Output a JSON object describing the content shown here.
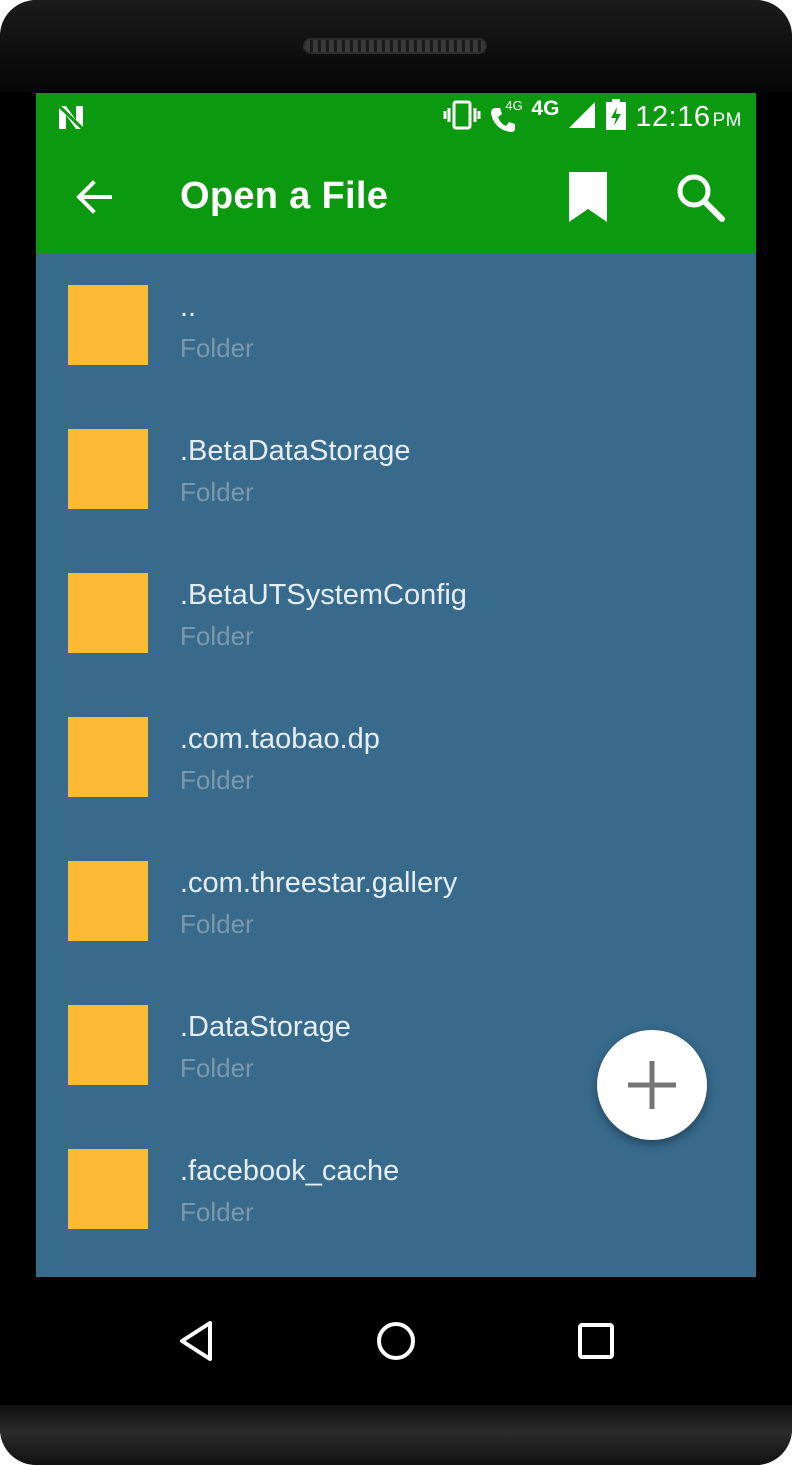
{
  "status_bar": {
    "network_label": "4G",
    "call_network_label": "4G",
    "time": "12:16",
    "ampm": "PM",
    "icons": [
      "n-notification-icon",
      "vibrate-icon",
      "wifi-calling-icon",
      "signal-icon",
      "battery-charging-icon"
    ]
  },
  "app_bar": {
    "title": "Open a File",
    "back_icon": "arrow-back-icon",
    "bookmark_icon": "bookmark-icon",
    "search_icon": "search-icon",
    "color": "#0b9a0f"
  },
  "files": [
    {
      "name": "..",
      "type": "Folder"
    },
    {
      "name": ".BetaDataStorage",
      "type": "Folder"
    },
    {
      "name": ".BetaUTSystemConfig",
      "type": "Folder"
    },
    {
      "name": ".com.taobao.dp",
      "type": "Folder"
    },
    {
      "name": ".com.threestar.gallery",
      "type": "Folder"
    },
    {
      "name": ".DataStorage",
      "type": "Folder"
    },
    {
      "name": ".facebook_cache",
      "type": "Folder"
    }
  ],
  "list_background": "#386a8c",
  "folder_icon_color": "#fcba36",
  "fab": {
    "icon": "plus-icon"
  },
  "nav_bar": {
    "icons": [
      "back-triangle-icon",
      "home-circle-icon",
      "recents-square-icon"
    ]
  }
}
